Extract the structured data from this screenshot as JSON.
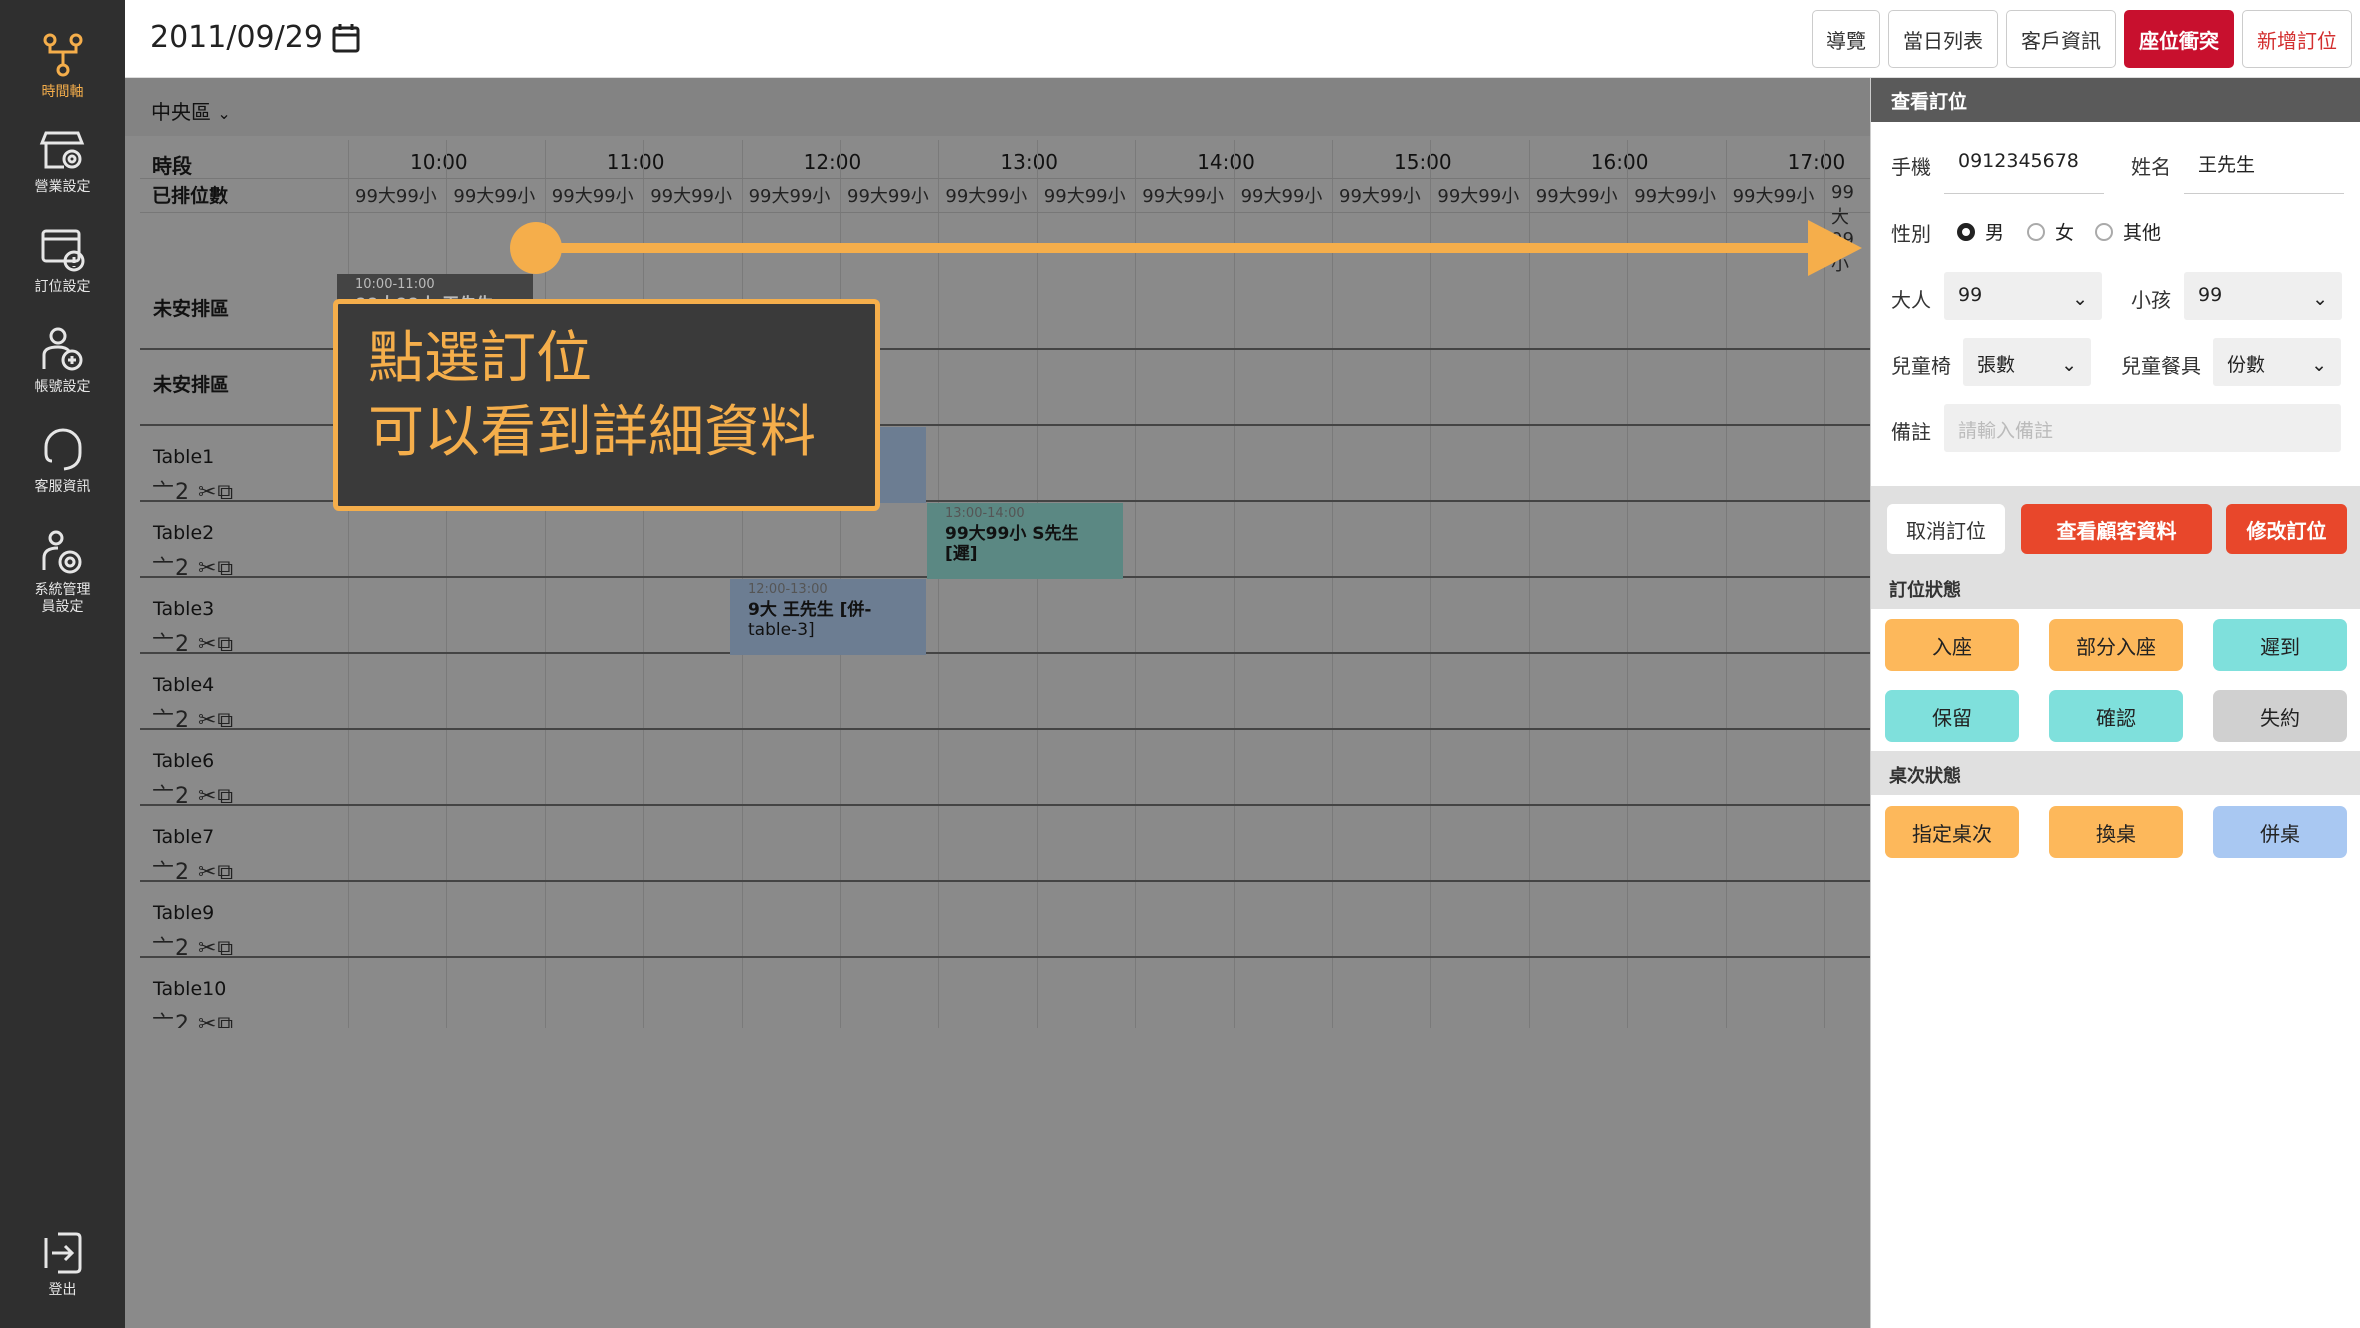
{
  "sidebar": {
    "items": [
      {
        "label": "時間軸",
        "icon": "timeline-icon"
      },
      {
        "label": "營業設定",
        "icon": "business-settings-icon"
      },
      {
        "label": "訂位設定",
        "icon": "booking-settings-icon"
      },
      {
        "label": "帳號設定",
        "icon": "account-settings-icon"
      },
      {
        "label": "客服資訊",
        "icon": "support-icon"
      },
      {
        "label": "系統管理",
        "label2": "員設定",
        "icon": "system-admin-icon"
      }
    ],
    "logout": "登出"
  },
  "header": {
    "date": "2011/09/29",
    "buttons": {
      "guide": "導覽",
      "daily": "當日列表",
      "customer": "客戶資訊",
      "conflict": "座位衝突",
      "new_booking": "新增訂位"
    }
  },
  "region": "中央區",
  "grid": {
    "time_label": "時段",
    "count_label": "已排位數",
    "hours": [
      "10:00",
      "11:00",
      "12:00",
      "13:00",
      "14:00",
      "15:00",
      "16:00",
      "17:00"
    ],
    "slot_count": "99大99小",
    "rows": [
      {
        "name": "未安排區",
        "icons": ""
      },
      {
        "name": "未安排區",
        "icons": ""
      },
      {
        "name": "Table1",
        "icons": "⼇2 ✂⧉"
      },
      {
        "name": "Table2",
        "icons": "⼇2 ✂⧉"
      },
      {
        "name": "Table3",
        "icons": "⼇2 ✂⧉"
      },
      {
        "name": "Table4",
        "icons": "⼇2 ✂⧉"
      },
      {
        "name": "Table6",
        "icons": "⼇2 ✂⧉"
      },
      {
        "name": "Table7",
        "icons": "⼇2 ✂⧉"
      },
      {
        "name": "Table9",
        "icons": "⼇2 ✂⧉"
      },
      {
        "name": "Table10",
        "icons": "⼇2 ✂⧉"
      }
    ],
    "bookings": [
      {
        "time": "10:00-11:00",
        "text": "99大99小 王先生"
      },
      {
        "time": "12:00-13:00",
        "text": "9大 王先生 [併-"
      },
      {
        "time": "13:00-14:00",
        "text": "99大99小 S先生",
        "text2": "[遲]"
      },
      {
        "time": "12:00-13:00",
        "text": "9大 王先生 [併-",
        "text2": "table-3]"
      }
    ]
  },
  "tooltip": {
    "line1": "點選訂位",
    "line2": "可以看到詳細資料"
  },
  "panel": {
    "title": "查看訂位",
    "phone_label": "手機",
    "phone": "0912345678",
    "name_label": "姓名",
    "name": "王先生",
    "gender_label": "性別",
    "gender_options": [
      "男",
      "女",
      "其他"
    ],
    "adult_label": "大人",
    "adult": "99",
    "child_label": "小孩",
    "child": "99",
    "chair_label": "兒童椅",
    "chair": "張數",
    "meal_label": "兒童餐具",
    "meal": "份數",
    "note_label": "備註",
    "note_placeholder": "請輸入備註",
    "cancel": "取消訂位",
    "view_customer": "查看顧客資料",
    "modify": "修改訂位",
    "status_head": "訂位狀態",
    "status": [
      "入座",
      "部分入座",
      "遲到",
      "保留",
      "確認",
      "失約"
    ],
    "table_head": "桌次狀態",
    "table_status": [
      "指定桌次",
      "換桌",
      "併桌"
    ]
  },
  "colors": {
    "accent": "#f5ae4b",
    "red": "#c8102e",
    "orange_red": "#e8472b",
    "teal": "#7fe0dc",
    "blue": "#a9c8f2"
  }
}
